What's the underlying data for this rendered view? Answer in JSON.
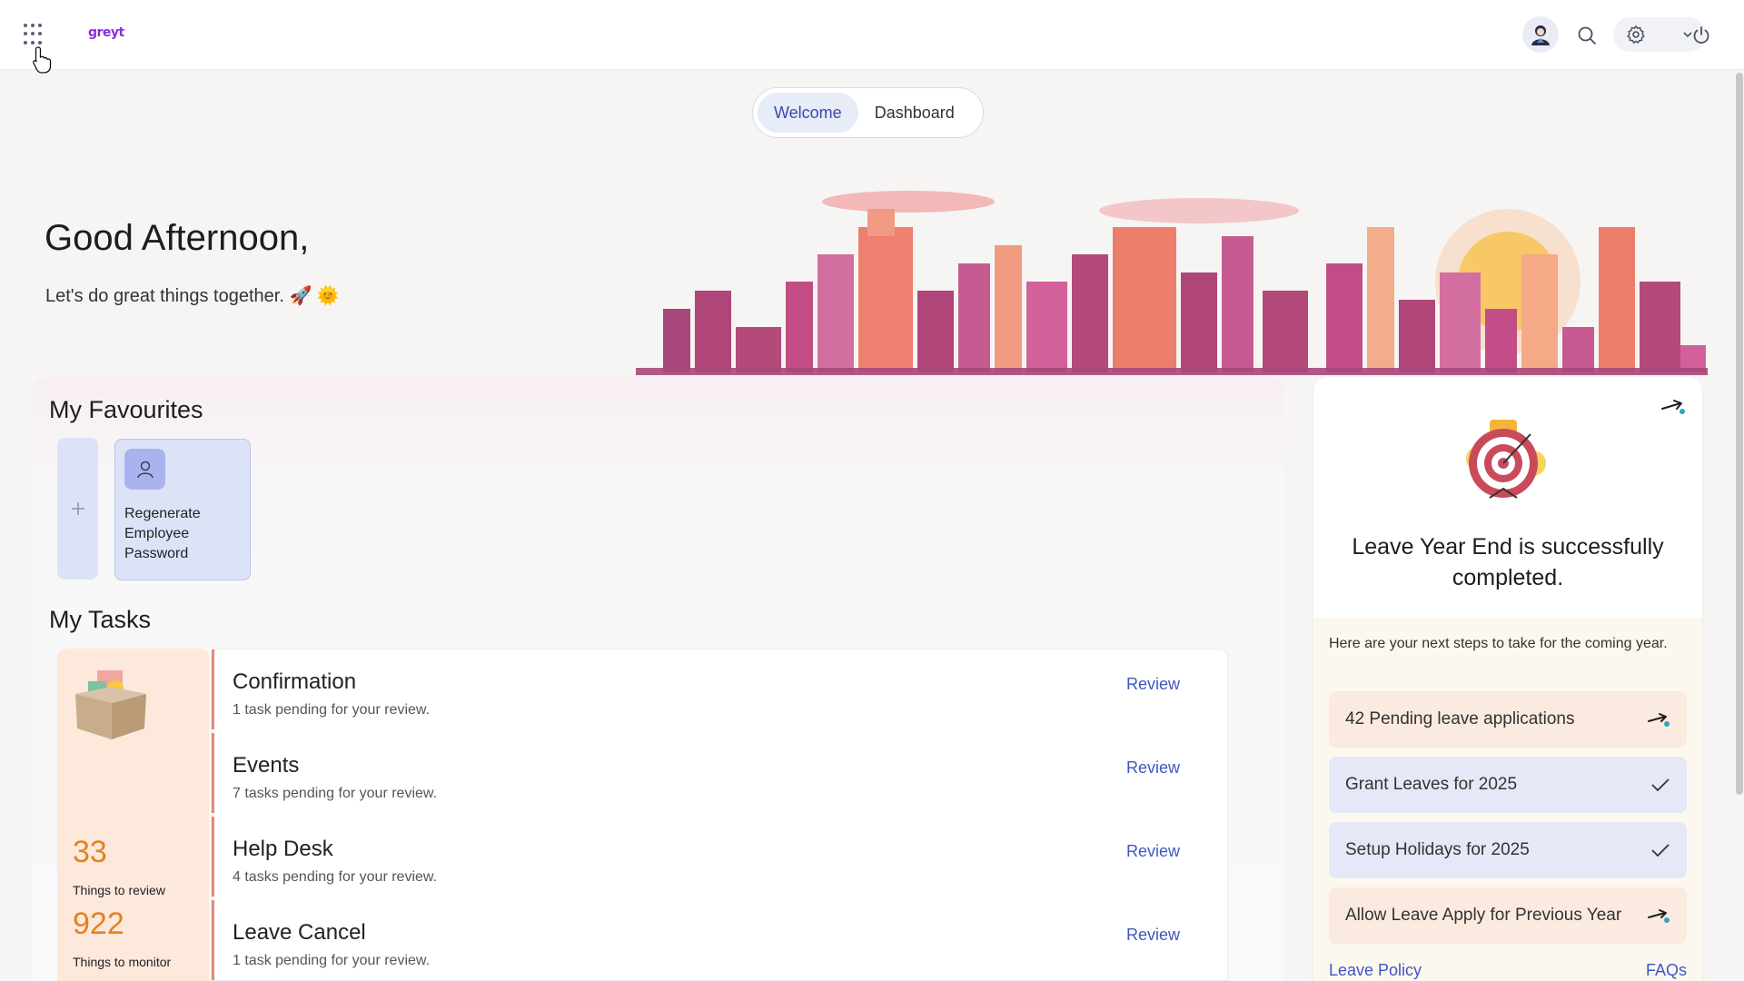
{
  "header": {
    "logo_text": "greyt",
    "icons": [
      "apps-grid-icon",
      "avatar-icon",
      "search-icon",
      "gear-icon",
      "chevron-down-icon",
      "power-icon"
    ]
  },
  "tabs": [
    {
      "label": "Welcome",
      "active": true
    },
    {
      "label": "Dashboard",
      "active": false
    }
  ],
  "greeting": {
    "title": "Good Afternoon,",
    "subtitle": "Let's do great things together. 🚀 🌞"
  },
  "favourites": {
    "title": "My Favourites",
    "items": [
      {
        "label": "Regenerate Employee Password",
        "icon": "user-icon"
      }
    ]
  },
  "tasks": {
    "title": "My Tasks",
    "stats": [
      {
        "value": "33",
        "label": "Things to review"
      },
      {
        "value": "922",
        "label": "Things to monitor"
      }
    ],
    "items": [
      {
        "title": "Confirmation",
        "subtitle": "1 task pending for your review.",
        "action": "Review"
      },
      {
        "title": "Events",
        "subtitle": "7 tasks pending for your review.",
        "action": "Review"
      },
      {
        "title": "Help Desk",
        "subtitle": "4 tasks pending for your review.",
        "action": "Review"
      },
      {
        "title": "Leave Cancel",
        "subtitle": "1 task pending for your review.",
        "action": "Review"
      }
    ]
  },
  "leave_card": {
    "title": "Leave Year End is successfully completed.",
    "steps_intro": "Here are your next steps to take for the coming year.",
    "steps": [
      {
        "label": "42 Pending leave applications",
        "status": "pending"
      },
      {
        "label": "Grant Leaves for 2025",
        "status": "done"
      },
      {
        "label": "Setup Holidays for 2025",
        "status": "done"
      },
      {
        "label": "Allow Leave Apply for Previous Year",
        "status": "pending"
      }
    ],
    "links": {
      "left": "Leave Policy",
      "right": "FAQs"
    }
  },
  "colors": {
    "accent_blue": "#3e56c4",
    "stat_orange": "#e48224",
    "task_border": "#e48a7a",
    "step_pending": "#fbeadf",
    "step_done": "#e5e8f6"
  }
}
